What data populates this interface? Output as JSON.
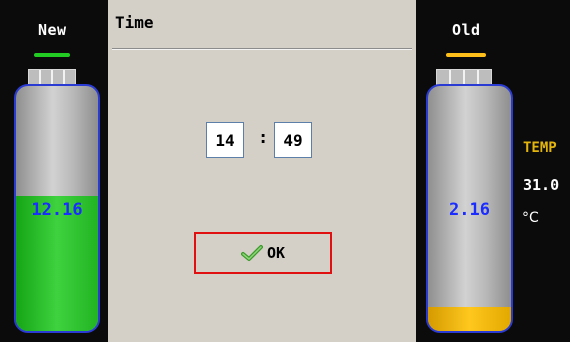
{
  "left": {
    "label": "New",
    "voltage": "12.16",
    "fill_fraction": 0.55,
    "indicator_color": "#22cc22",
    "fill_color": "#33cc33"
  },
  "right": {
    "label": "Old",
    "voltage": "2.16",
    "fill_fraction": 0.1,
    "indicator_color": "#ffbf1a",
    "fill_color": "#ffc81e"
  },
  "temperature": {
    "label": "TEMP",
    "value": "31.0",
    "unit": "°C"
  },
  "dialog": {
    "title": "Time",
    "hour": "14",
    "separator": ":",
    "minute": "49",
    "ok_label": "OK",
    "ok_icon": "checkmark-icon"
  },
  "colors": {
    "battery_border": "#2a3bd4",
    "voltage_text": "#1a2cff",
    "temp_label": "#e2b40c",
    "ok_border": "#e01010"
  }
}
